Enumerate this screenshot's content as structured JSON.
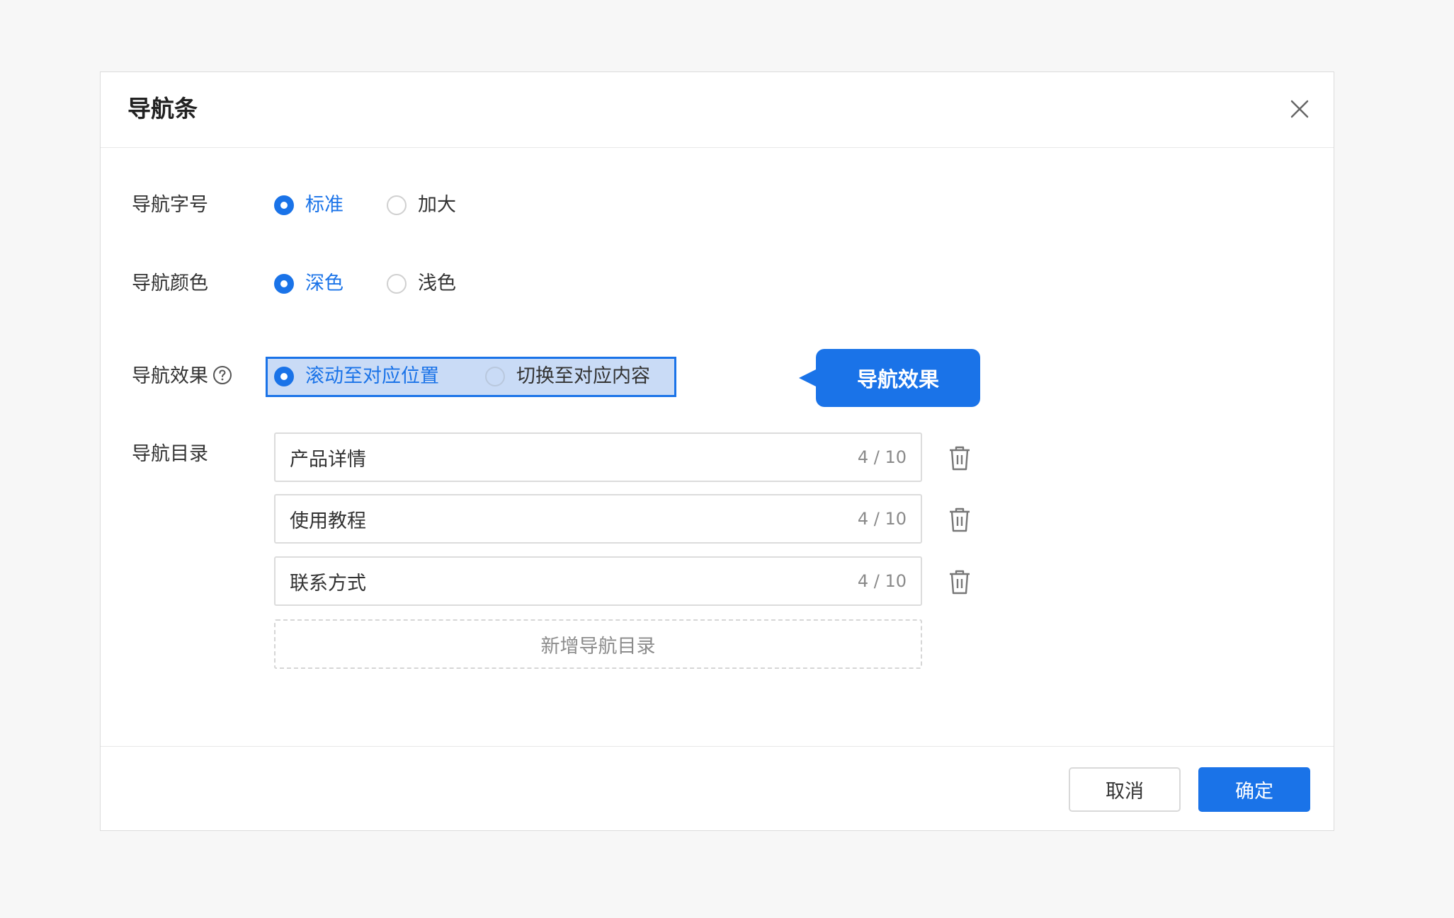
{
  "dialog": {
    "title": "导航条",
    "close_icon": "close-icon"
  },
  "form": {
    "font_size": {
      "label": "导航字号",
      "options": [
        {
          "label": "标准",
          "checked": true
        },
        {
          "label": "加大",
          "checked": false
        }
      ]
    },
    "color": {
      "label": "导航颜色",
      "options": [
        {
          "label": "深色",
          "checked": true
        },
        {
          "label": "浅色",
          "checked": false
        }
      ]
    },
    "effect": {
      "label": "导航效果",
      "help_icon": "question-circle-icon",
      "options": [
        {
          "label": "滚动至对应位置",
          "checked": true
        },
        {
          "label": "切换至对应内容",
          "checked": false
        }
      ],
      "callout": "导航效果"
    },
    "directory": {
      "label": "导航目录",
      "items": [
        {
          "value": "产品详情",
          "counter": "4 / 10"
        },
        {
          "value": "使用教程",
          "counter": "4 / 10"
        },
        {
          "value": "联系方式",
          "counter": "4 / 10"
        }
      ],
      "delete_icon": "trash-icon",
      "add_label": "新增导航目录"
    }
  },
  "footer": {
    "cancel_label": "取消",
    "ok_label": "确定"
  },
  "colors": {
    "accent": "#1a73e8",
    "highlight": "#c9dbf6",
    "background": "#f7f7f7"
  }
}
